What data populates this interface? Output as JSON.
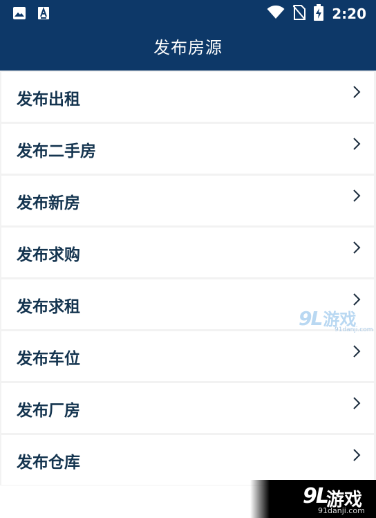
{
  "status_bar": {
    "time": "2:20",
    "icons": [
      "image-icon",
      "text-a-icon",
      "wifi-icon",
      "no-sim-icon",
      "battery-charging-icon"
    ]
  },
  "app_bar": {
    "title": "发布房源"
  },
  "menu": {
    "items": [
      {
        "label": "发布出租"
      },
      {
        "label": "发布二手房"
      },
      {
        "label": "发布新房"
      },
      {
        "label": "发布求购"
      },
      {
        "label": "发布求租"
      },
      {
        "label": "发布车位"
      },
      {
        "label": "发布厂房"
      },
      {
        "label": "发布仓库"
      }
    ]
  },
  "watermarks": {
    "center": {
      "mark": "9L",
      "name": "游戏",
      "site": "91danji.com"
    },
    "corner": {
      "mark": "9L",
      "name": "游戏",
      "site": "91danji.com"
    }
  },
  "colors": {
    "header": "#0d3868",
    "label": "#14344f",
    "background": "#f2f2f2"
  }
}
